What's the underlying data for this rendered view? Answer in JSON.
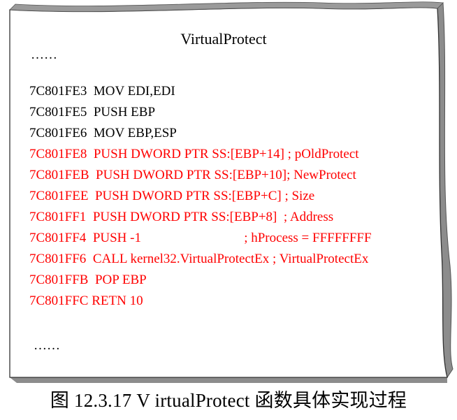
{
  "document": {
    "title": "VirtualProtect",
    "ellipsis_top": "……",
    "ellipsis_bottom": "……",
    "lines": [
      {
        "addr": "7C801FE3",
        "gap": "  ",
        "text": "MOV EDI,EDI",
        "highlight": false
      },
      {
        "addr": "7C801FE5",
        "gap": "  ",
        "text": "PUSH EBP",
        "highlight": false
      },
      {
        "addr": "7C801FE6",
        "gap": "  ",
        "text": "MOV EBP,ESP",
        "highlight": false
      },
      {
        "addr": "7C801FE8",
        "gap": "  ",
        "text": "PUSH DWORD PTR SS:[EBP+14] ; pOldProtect",
        "highlight": true
      },
      {
        "addr": "7C801FEB",
        "gap": "  ",
        "text": "PUSH DWORD PTR SS:[EBP+10]; NewProtect",
        "highlight": true
      },
      {
        "addr": "7C801FEE",
        "gap": "  ",
        "text": "PUSH DWORD PTR SS:[EBP+C] ; Size",
        "highlight": true
      },
      {
        "addr": "7C801FF1",
        "gap": "  ",
        "text": "PUSH DWORD PTR SS:[EBP+8]  ; Address",
        "highlight": true
      },
      {
        "addr": "7C801FF4",
        "gap": "  ",
        "text": "PUSH -1                               ; hProcess = FFFFFFFF",
        "highlight": true
      },
      {
        "addr": "7C801FF6",
        "gap": "  ",
        "text": "CALL kernel32.VirtualProtectEx ; VirtualProtectEx",
        "highlight": true
      },
      {
        "addr": "7C801FFB",
        "gap": "  ",
        "text": "POP EBP",
        "highlight": true
      },
      {
        "addr": "7C801FFC",
        "gap": " ",
        "text": "RETN 10",
        "highlight": true
      }
    ]
  },
  "caption": "图 12.3.17  V irtualProtect 函数具体实现过程",
  "colors": {
    "highlight": "#ff0000",
    "text": "#000000",
    "paper_shadow": "#8c8c8c"
  }
}
